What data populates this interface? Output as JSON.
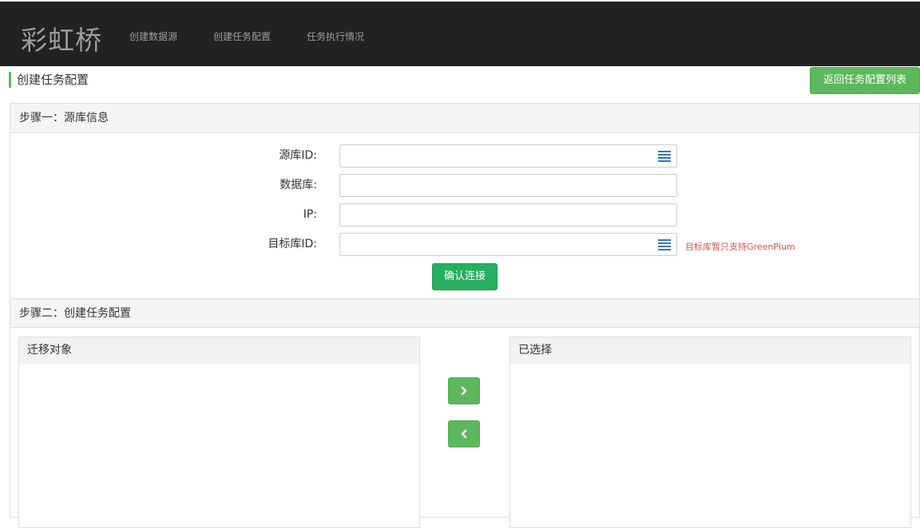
{
  "navbar": {
    "brand": "彩虹桥",
    "items": [
      {
        "label": "创建数据源"
      },
      {
        "label": "创建任务配置"
      },
      {
        "label": "任务执行情况"
      }
    ]
  },
  "page": {
    "title": "创建任务配置",
    "back_label": "返回任务配置列表"
  },
  "step1": {
    "heading": "步骤一：源库信息",
    "fields": [
      {
        "label": "源库ID:",
        "value": "",
        "icon": "list-icon"
      },
      {
        "label": "数据库:",
        "value": ""
      },
      {
        "label": "IP:",
        "value": ""
      },
      {
        "label": "目标库ID:",
        "value": "",
        "icon": "list-icon"
      }
    ],
    "hint": "目标库暂只支持GreenPlum",
    "confirm_label": "确认连接"
  },
  "step2": {
    "heading": "步骤二：创建任务配置",
    "source_title": "迁移对象",
    "target_title": "已选择",
    "source_items": [],
    "target_items": [],
    "move_right_icon": "chevron-right-icon",
    "move_left_icon": "chevron-left-icon"
  },
  "colors": {
    "navbar_bg": "#222222",
    "accent_green": "#5cb85c",
    "confirm_green": "#27ae60",
    "icon_blue": "#337ab7",
    "hint_red": "#d9534f"
  }
}
